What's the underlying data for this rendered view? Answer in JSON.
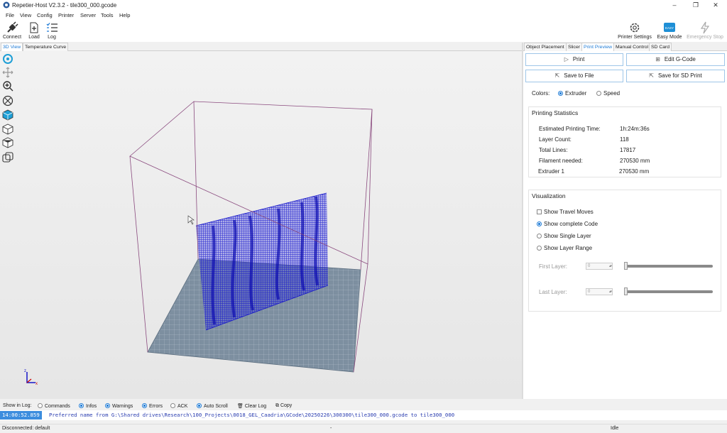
{
  "window": {
    "title": "Repetier-Host V2.3.2 - tile300_000.gcode"
  },
  "menu": [
    "File",
    "View",
    "Config",
    "Printer",
    "Server",
    "Tools",
    "Help"
  ],
  "toolbar": {
    "connect": "Connect",
    "load": "Load",
    "log": "Log",
    "printer_settings": "Printer Settings",
    "easy_mode": "Easy Mode",
    "easy_badge": "EASY",
    "emergency_stop": "Emergency Stop"
  },
  "left_tabs": [
    "3D View",
    "Temperature Curve"
  ],
  "right_tabs": [
    "Object Placement",
    "Slicer",
    "Print Preview",
    "Manual Control",
    "SD Card"
  ],
  "panel": {
    "print": "Print",
    "edit_gcode": "Edit G-Code",
    "save_to_file": "Save to File",
    "save_for_sd": "Save for SD Print",
    "colors_label": "Colors:",
    "color_extruder": "Extruder",
    "color_speed": "Speed",
    "stats_title": "Printing Statistics",
    "stats": [
      {
        "label": "Estimated Printing Time:",
        "value": "1h:24m:36s"
      },
      {
        "label": "Layer Count:",
        "value": "118"
      },
      {
        "label": "Total Lines:",
        "value": "17817"
      },
      {
        "label": "Filament needed:",
        "value": "270530 mm"
      },
      {
        "label": "Extruder 1",
        "value": "270530 mm"
      }
    ],
    "vis_title": "Visualization",
    "show_travel": "Show Travel Moves",
    "show_complete": "Show complete Code",
    "show_single": "Show Single Layer",
    "show_range": "Show Layer Range",
    "first_layer": "First Layer:",
    "first_value": "0",
    "last_layer": "Last Layer:",
    "last_value": "0"
  },
  "log_filters": {
    "show_in_log": "Show in Log:",
    "commands": "Commands",
    "infos": "Infos",
    "warnings": "Warnings",
    "errors": "Errors",
    "ack": "ACK",
    "auto_scroll": "Auto Scroll",
    "clear_log": "Clear Log",
    "copy": "Copy"
  },
  "log": {
    "timestamp": "14:00:52.859",
    "message": "Preferred name from G:\\Shared drives\\Research\\100_Projects\\0018_GEL_Caadria\\GCode\\20250226\\300300\\tile300_000.gcode to tile300_000"
  },
  "status": {
    "connection": "Disconnected: default",
    "dash": "-",
    "state": "Idle"
  },
  "axis": {
    "z": "z",
    "x": "x"
  },
  "colors": {
    "accent": "#1e7bd6",
    "print_color": "#1515c8",
    "bed": "#7d8fa0",
    "frame": "#8a4a7e"
  }
}
